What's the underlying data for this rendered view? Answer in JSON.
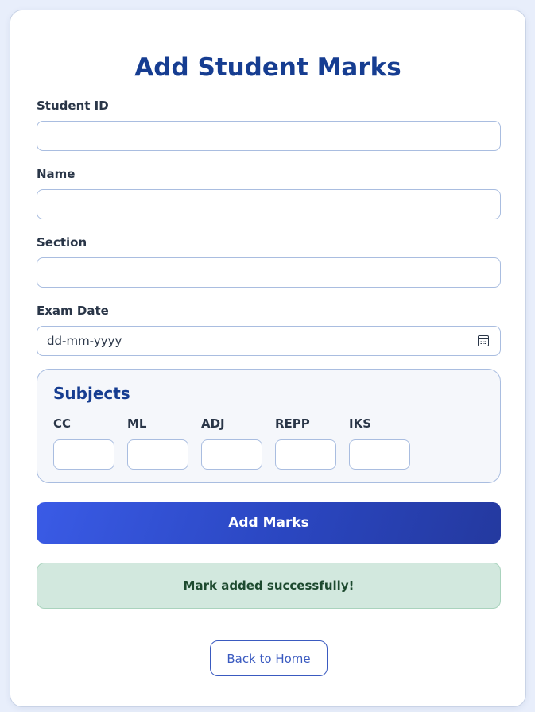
{
  "form": {
    "title": "Add Student Marks",
    "fields": [
      {
        "label": "Student ID",
        "value": "",
        "placeholder": ""
      },
      {
        "label": "Name",
        "value": "",
        "placeholder": ""
      },
      {
        "label": "Section",
        "value": "",
        "placeholder": ""
      }
    ],
    "exam_date": {
      "label": "Exam Date",
      "placeholder": "dd-mm-yyyy",
      "icon": "calendar-icon"
    },
    "subjects": {
      "title": "Subjects",
      "items": [
        {
          "label": "CC",
          "value": ""
        },
        {
          "label": "ML",
          "value": ""
        },
        {
          "label": "ADJ",
          "value": ""
        },
        {
          "label": "REPP",
          "value": ""
        },
        {
          "label": "IKS",
          "value": ""
        }
      ]
    },
    "submit_label": "Add Marks",
    "success_message": "Mark added successfully!",
    "back_label": "Back to Home"
  },
  "colors": {
    "title": "#163d91",
    "button_gradient_start": "#3a5be6",
    "button_gradient_end": "#24399f",
    "success_bg": "#d2e8de",
    "success_text": "#1d4a2f",
    "link": "#3a5ac0"
  }
}
